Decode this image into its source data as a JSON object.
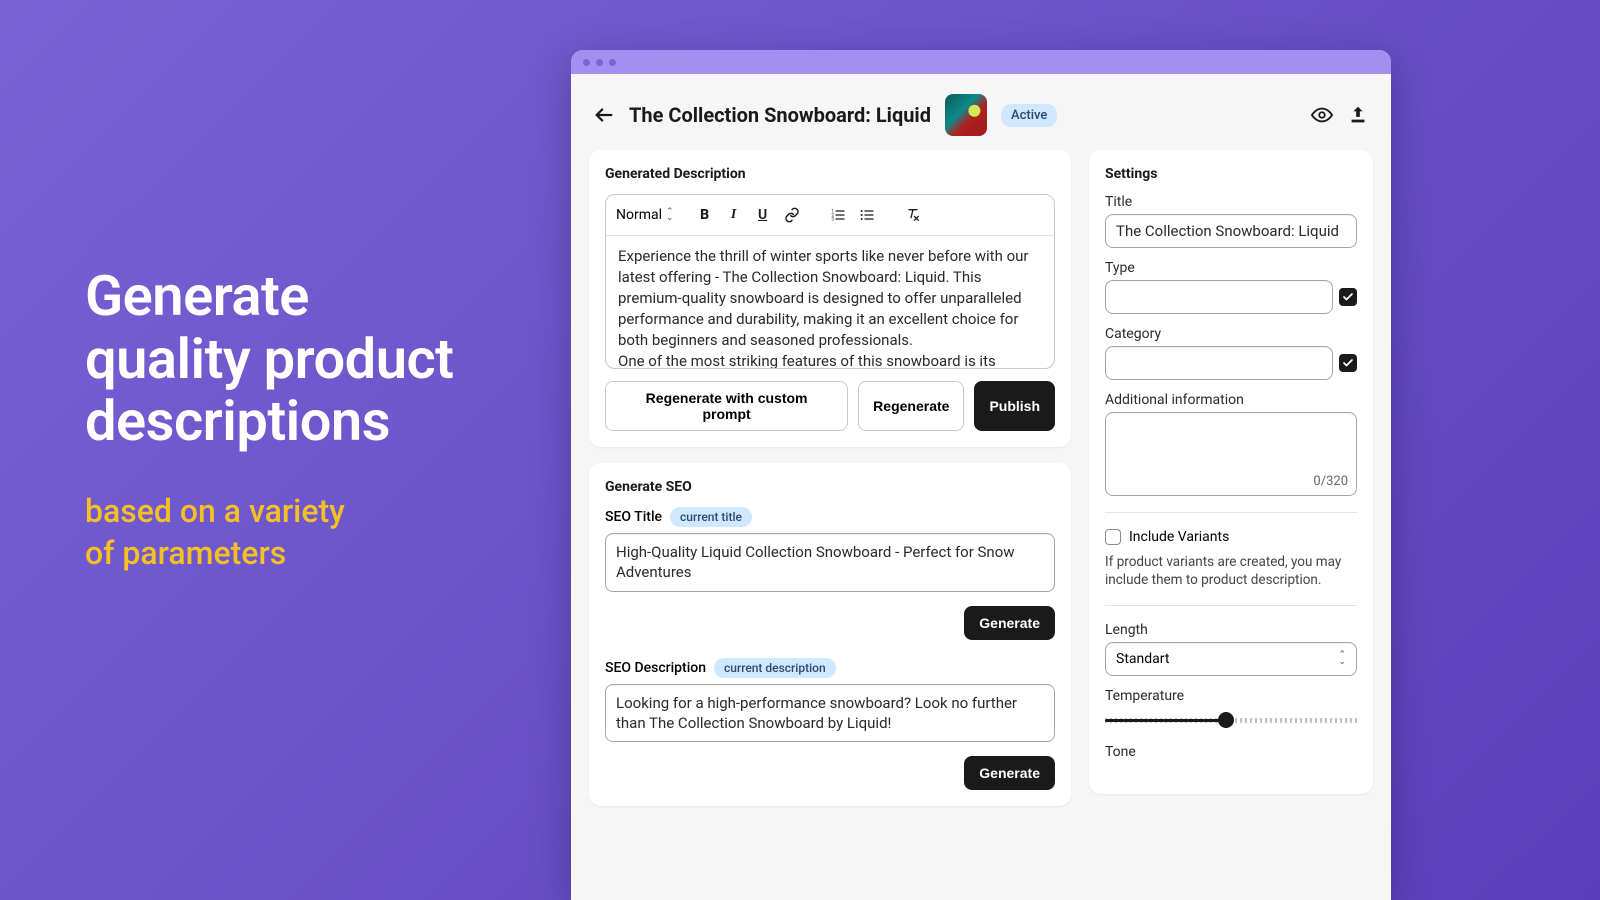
{
  "hero": {
    "line1": "Generate",
    "line2": "quality product",
    "line3": "descriptions",
    "sub1": "based on a variety",
    "sub2": "of parameters"
  },
  "header": {
    "title": "The Collection Snowboard: Liquid",
    "status": "Active"
  },
  "description_card": {
    "title": "Generated Description",
    "editor": {
      "style_label": "Normal",
      "content": "Experience the thrill of winter sports like never before with our latest offering - The Collection Snowboard: Liquid. This premium-quality snowboard is designed to offer unparalleled performance and durability, making it an excellent choice for both beginners and seasoned professionals.\nOne of the most striking features of this snowboard is its elegan…"
    },
    "buttons": {
      "regenerate_custom": "Regenerate with custom prompt",
      "regenerate": "Regenerate",
      "publish": "Publish"
    }
  },
  "seo_card": {
    "title": "Generate SEO",
    "seo_title": {
      "label": "SEO Title",
      "chip": "current title",
      "value": "High-Quality Liquid Collection Snowboard - Perfect for Snow Adventures",
      "button": "Generate"
    },
    "seo_description": {
      "label": "SEO Description",
      "chip": "current description",
      "value": "Looking for a high-performance snowboard? Look no further than The Collection Snowboard by Liquid!",
      "button": "Generate"
    }
  },
  "settings": {
    "title": "Settings",
    "title_field": {
      "label": "Title",
      "value": "The Collection Snowboard: Liquid"
    },
    "type_field": {
      "label": "Type",
      "value": ""
    },
    "category_field": {
      "label": "Category",
      "value": ""
    },
    "additional": {
      "label": "Additional information",
      "counter": "0/320"
    },
    "variants": {
      "label": "Include Variants",
      "help": "If product variants are created, you may include them to product description."
    },
    "length": {
      "label": "Length",
      "value": "Standart"
    },
    "temperature": {
      "label": "Temperature",
      "percent": 48
    },
    "tone": {
      "label": "Tone"
    }
  }
}
